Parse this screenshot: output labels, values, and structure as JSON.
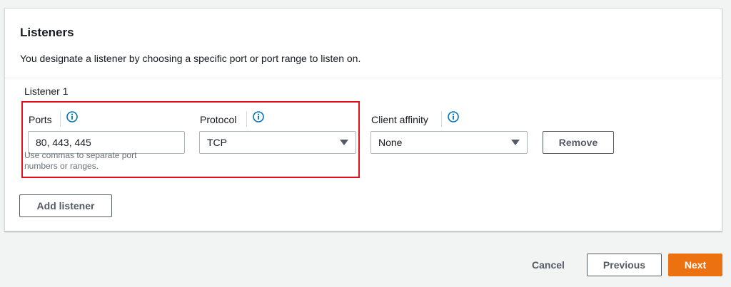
{
  "panel": {
    "title": "Listeners",
    "description": "You designate a listener by choosing a specific port or port range to listen on."
  },
  "listener": {
    "heading": "Listener 1",
    "ports": {
      "label": "Ports",
      "value": "80, 443, 445",
      "hint": "Use commas to separate port numbers or ranges."
    },
    "protocol": {
      "label": "Protocol",
      "value": "TCP"
    },
    "client_affinity": {
      "label": "Client affinity",
      "value": "None"
    },
    "remove_label": "Remove"
  },
  "add_listener_label": "Add listener",
  "footer": {
    "cancel_label": "Cancel",
    "previous_label": "Previous",
    "next_label": "Next"
  },
  "colors": {
    "highlight": "#e8101a",
    "info_icon": "#0073bb",
    "primary": "#ec7211"
  },
  "icons": {
    "info": "info-icon",
    "dropdown": "caret-down-icon"
  }
}
